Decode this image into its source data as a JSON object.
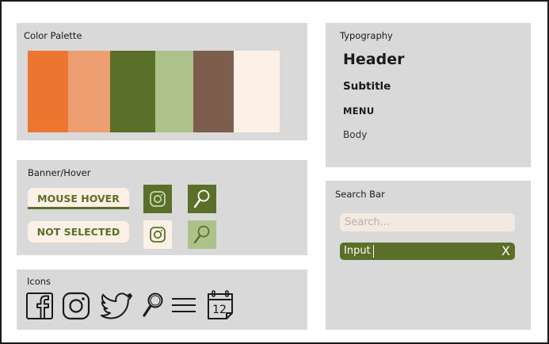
{
  "palette": {
    "title": "Color Palette",
    "colors": [
      {
        "name": "orange",
        "hex": "#ec752f"
      },
      {
        "name": "light-orange",
        "hex": "#ed9e70"
      },
      {
        "name": "dark-green",
        "hex": "#5a7029"
      },
      {
        "name": "light-green",
        "hex": "#adc28b"
      },
      {
        "name": "brown",
        "hex": "#7d5e4c"
      },
      {
        "name": "cream",
        "hex": "#fdf0e6"
      }
    ]
  },
  "typography": {
    "title": "Typography",
    "header": "Header",
    "subtitle": "Subtitle",
    "menu": "MENU",
    "body": "Body"
  },
  "banner": {
    "title": "Banner/Hover",
    "hover_label": "MOUSE HOVER",
    "not_selected_label": "NOT SELECTED",
    "icons": [
      "instagram-icon",
      "search-icon"
    ]
  },
  "icons": {
    "title": "Icons",
    "items": [
      "facebook-icon",
      "instagram-icon",
      "twitter-icon",
      "search-icon",
      "menu-icon",
      "calendar-icon"
    ],
    "calendar_day": "12"
  },
  "search": {
    "title": "Search Bar",
    "placeholder": "Search...",
    "active_value": "Input",
    "clear_label": "X"
  },
  "colors": {
    "panel_bg": "#d9d9d9",
    "accent": "#5a7029",
    "accent_light": "#adc28b",
    "cream": "#fdf0e6"
  }
}
